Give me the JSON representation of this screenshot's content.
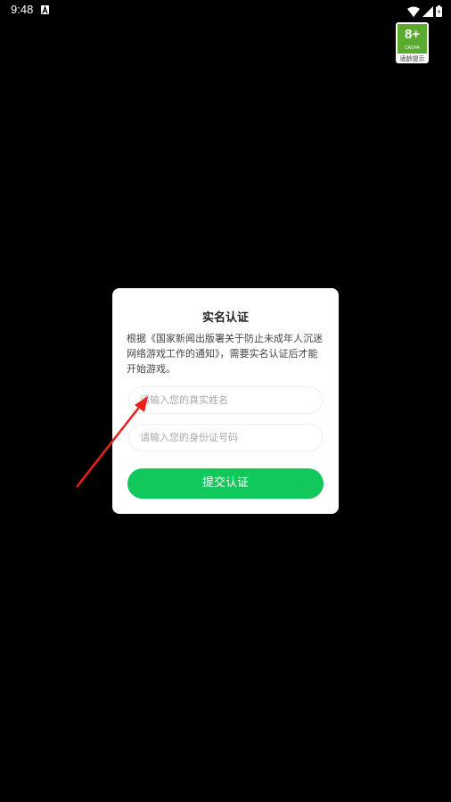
{
  "status_bar": {
    "time": "9:48",
    "app_icon": "font-a-icon",
    "icons": [
      "wifi-icon",
      "signal-icon",
      "battery-icon"
    ]
  },
  "age_badge": {
    "rating": "8+",
    "org": "CADPA",
    "caption": "适龄提示",
    "color": "#5aaa2e"
  },
  "dialog": {
    "title": "实名认证",
    "message": "根据《国家新闻出版署关于防止未成年人沉迷网络游戏工作的通知》，需要实名认证后才能开始游戏。",
    "name_input": {
      "placeholder": "请输入您的真实姓名",
      "value": ""
    },
    "id_input": {
      "placeholder": "请输入您的身份证号码",
      "value": ""
    },
    "submit_label": "提交认证",
    "accent_color": "#13c85a"
  },
  "annotation": {
    "type": "arrow",
    "color": "#e8201c",
    "target": "name_input"
  }
}
